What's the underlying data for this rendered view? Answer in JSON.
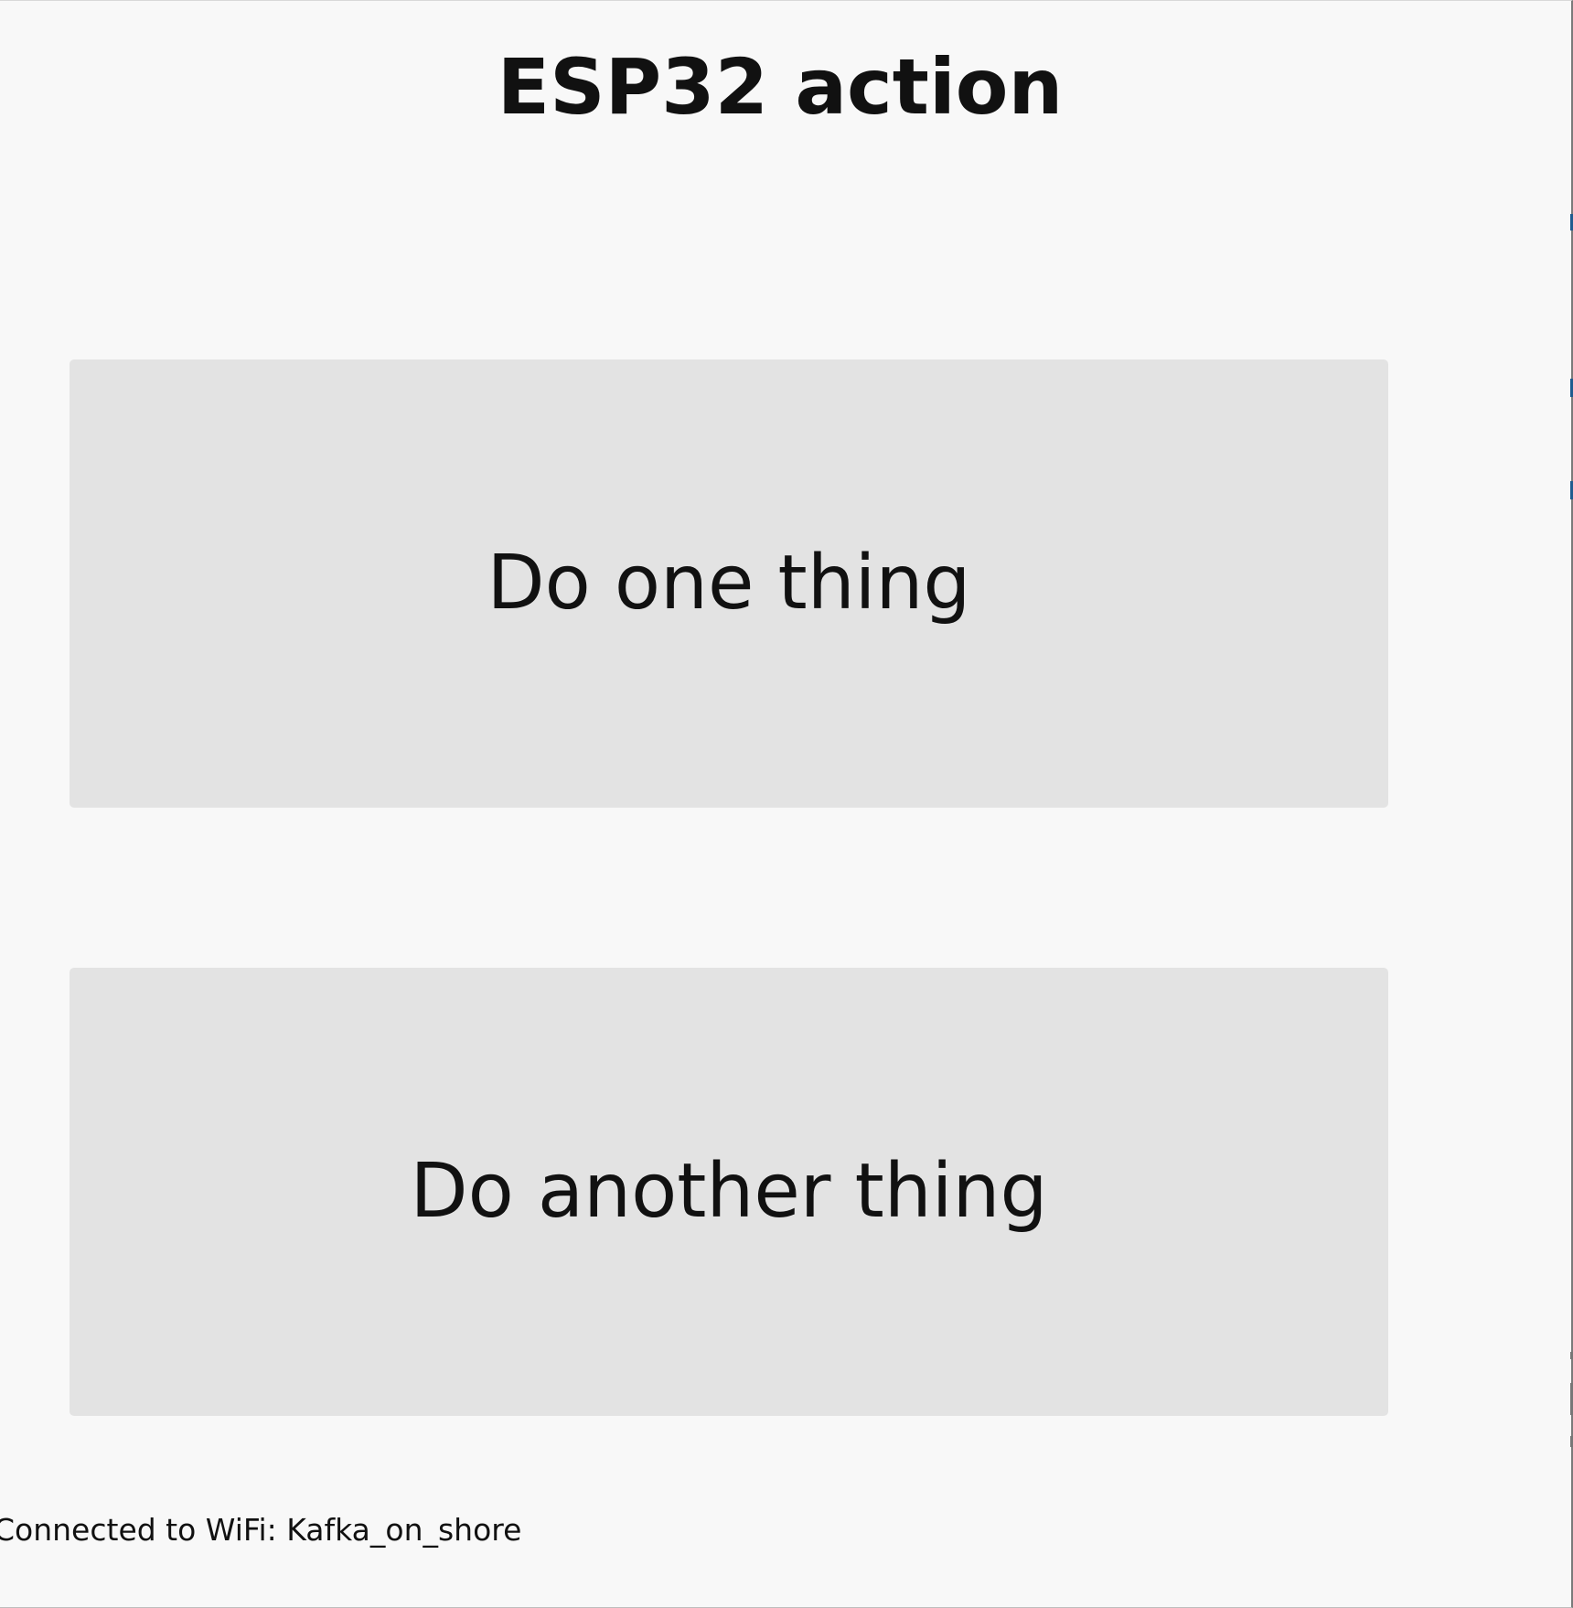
{
  "page": {
    "title": "ESP32 action"
  },
  "actions": {
    "first_label": "Do one thing",
    "second_label": "Do another thing"
  },
  "status": {
    "wifi": "Connected to WiFi: Kafka_on_shore"
  },
  "colors": {
    "background": "#f8f8f8",
    "button": "#e3e3e3",
    "text": "#111111"
  }
}
